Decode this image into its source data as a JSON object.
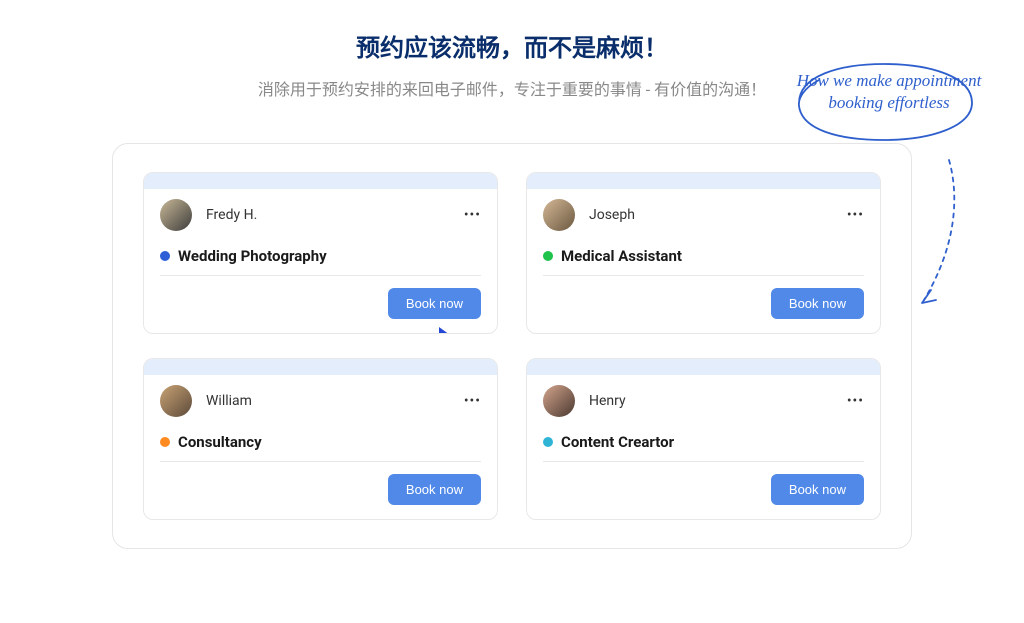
{
  "header": {
    "title": "预约应该流畅，而不是麻烦！",
    "subtitle": "消除用于预约安排的来回电子邮件，专注于重要的事情 - 有价值的沟通！"
  },
  "annotation": {
    "text": "How we make appointment booking effortless"
  },
  "cards": [
    {
      "user": "Fredy H.",
      "service": "Wedding Photography",
      "dotColor": "blue",
      "button": "Book now"
    },
    {
      "user": "Joseph",
      "service": "Medical Assistant",
      "dotColor": "green",
      "button": "Book now"
    },
    {
      "user": "William",
      "service": "Consultancy",
      "dotColor": "orange",
      "button": "Book now"
    },
    {
      "user": "Henry",
      "service": "Content Creartor",
      "dotColor": "cyan",
      "button": "Book now"
    }
  ]
}
